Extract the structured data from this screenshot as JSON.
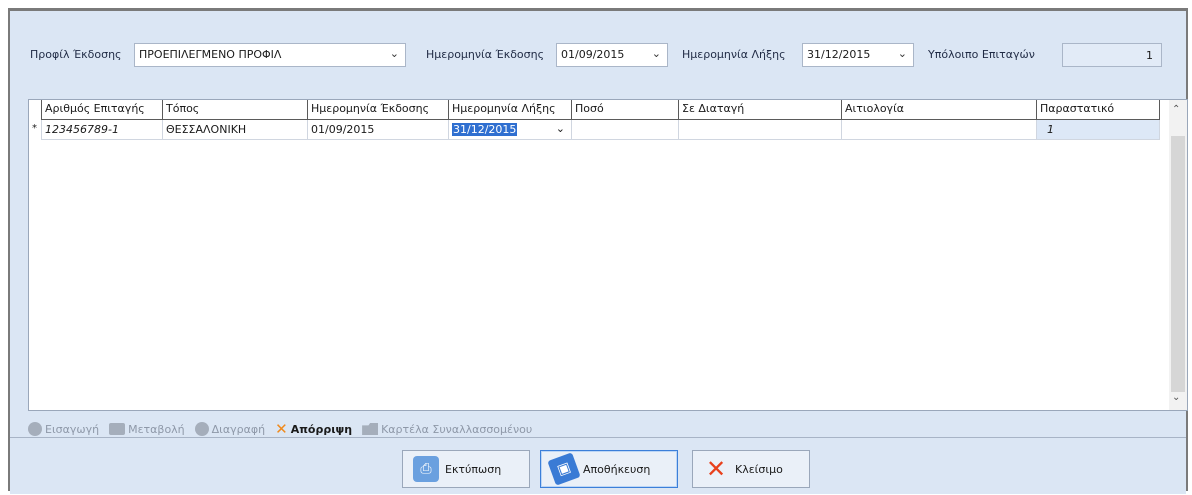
{
  "filters": {
    "profile_label": "Προφίλ Έκδοσης",
    "profile_value": "ΠΡΟΕΠΙΛΕΓΜΕΝΟ ΠΡΟΦΙΛ",
    "issue_date_label": "Ημερομηνία Έκδοσης",
    "issue_date_value": "01/09/2015",
    "expiry_date_label": "Ημερομηνία Λήξης",
    "expiry_date_value": "31/12/2015",
    "balance_label": "Υπόλοιπο Επιταγών",
    "balance_value": "1"
  },
  "grid": {
    "columns": [
      "Αριθμός Επιταγής",
      "Τόπος",
      "Ημερομηνία Έκδοσης",
      "Ημερομηνία Λήξης",
      "Ποσό",
      "Σε Διαταγή",
      "Αιτιολογία",
      "Παραστατικό"
    ],
    "row_marker": "*",
    "rows": [
      {
        "cheque": "123456789-1",
        "place": "ΘΕΣΣΑΛΟΝΙΚΗ",
        "issue": "01/09/2015",
        "expiry": "31/12/2015",
        "amount": "",
        "order": "",
        "reason": "",
        "doc": "1"
      }
    ]
  },
  "actions": {
    "insert": "Εισαγωγή",
    "edit": "Μεταβολή",
    "delete": "Διαγραφή",
    "reject": "Απόρριψη",
    "card": "Καρτέλα Συναλλασσομένου"
  },
  "buttons": {
    "print": "Εκτύπωση",
    "save": "Αποθήκευση",
    "close": "Κλείσιμο"
  }
}
